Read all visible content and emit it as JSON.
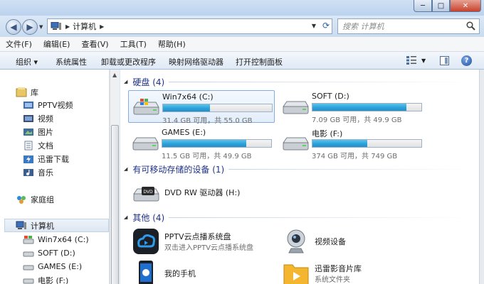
{
  "window": {
    "buttons": {
      "minimize": "─",
      "maximize": "□",
      "close": "✕"
    }
  },
  "address": {
    "crumb": "计算机",
    "search_placeholder": "搜索 计算机"
  },
  "menu": [
    "文件(F)",
    "编辑(E)",
    "查看(V)",
    "工具(T)",
    "帮助(H)"
  ],
  "commands": {
    "organize": "组织 ▾",
    "system_properties": "系统属性",
    "uninstall": "卸载或更改程序",
    "map_drive": "映射网络驱动器",
    "control_panel": "打开控制面板"
  },
  "nav": {
    "library": "库",
    "libraries": [
      "PPTV视频",
      "视频",
      "图片",
      "文档",
      "迅雷下载",
      "音乐"
    ],
    "homegroup": "家庭组",
    "computer": "计算机",
    "drives": [
      "Win7x64 (C:)",
      "SOFT (D:)",
      "GAMES (E:)",
      "电影 (F:)"
    ]
  },
  "groups": {
    "hard_disks": "硬盘 (4)",
    "removable": "有可移动存储的设备 (1)",
    "other": "其他 (4)"
  },
  "drives": [
    {
      "name": "Win7x64 (C:)",
      "free": "31.4 GB 可用，共 55.0 GB",
      "used_fraction": 0.43,
      "selected": true
    },
    {
      "name": "SOFT (D:)",
      "free": "7.09 GB 可用，共 49.9 GB",
      "used_fraction": 0.86,
      "selected": false
    },
    {
      "name": "GAMES (E:)",
      "free": "11.5 GB 可用，共 49.9 GB",
      "used_fraction": 0.77,
      "selected": false
    },
    {
      "name": "电影 (F:)",
      "free": "374 GB 可用，共 749 GB",
      "used_fraction": 0.5,
      "selected": false
    }
  ],
  "removable": [
    {
      "name": "DVD RW 驱动器 (H:)",
      "icon": "dvd-drive-icon"
    }
  ],
  "other": [
    {
      "name": "PPTV云点播系统盘",
      "desc": "双击进入PPTV云点播系统盘",
      "icon": "pptv-cloud-icon"
    },
    {
      "name": "视频设备",
      "desc": "",
      "icon": "webcam-icon"
    },
    {
      "name": "我的手机",
      "desc": "",
      "icon": "phone-icon"
    },
    {
      "name": "迅雷影音片库",
      "desc": "系统文件夹",
      "icon": "thunder-video-folder-icon"
    }
  ],
  "colors": {
    "accent": "#26a0da",
    "group_title": "#1e3287",
    "selection_border": "#84acdd"
  }
}
